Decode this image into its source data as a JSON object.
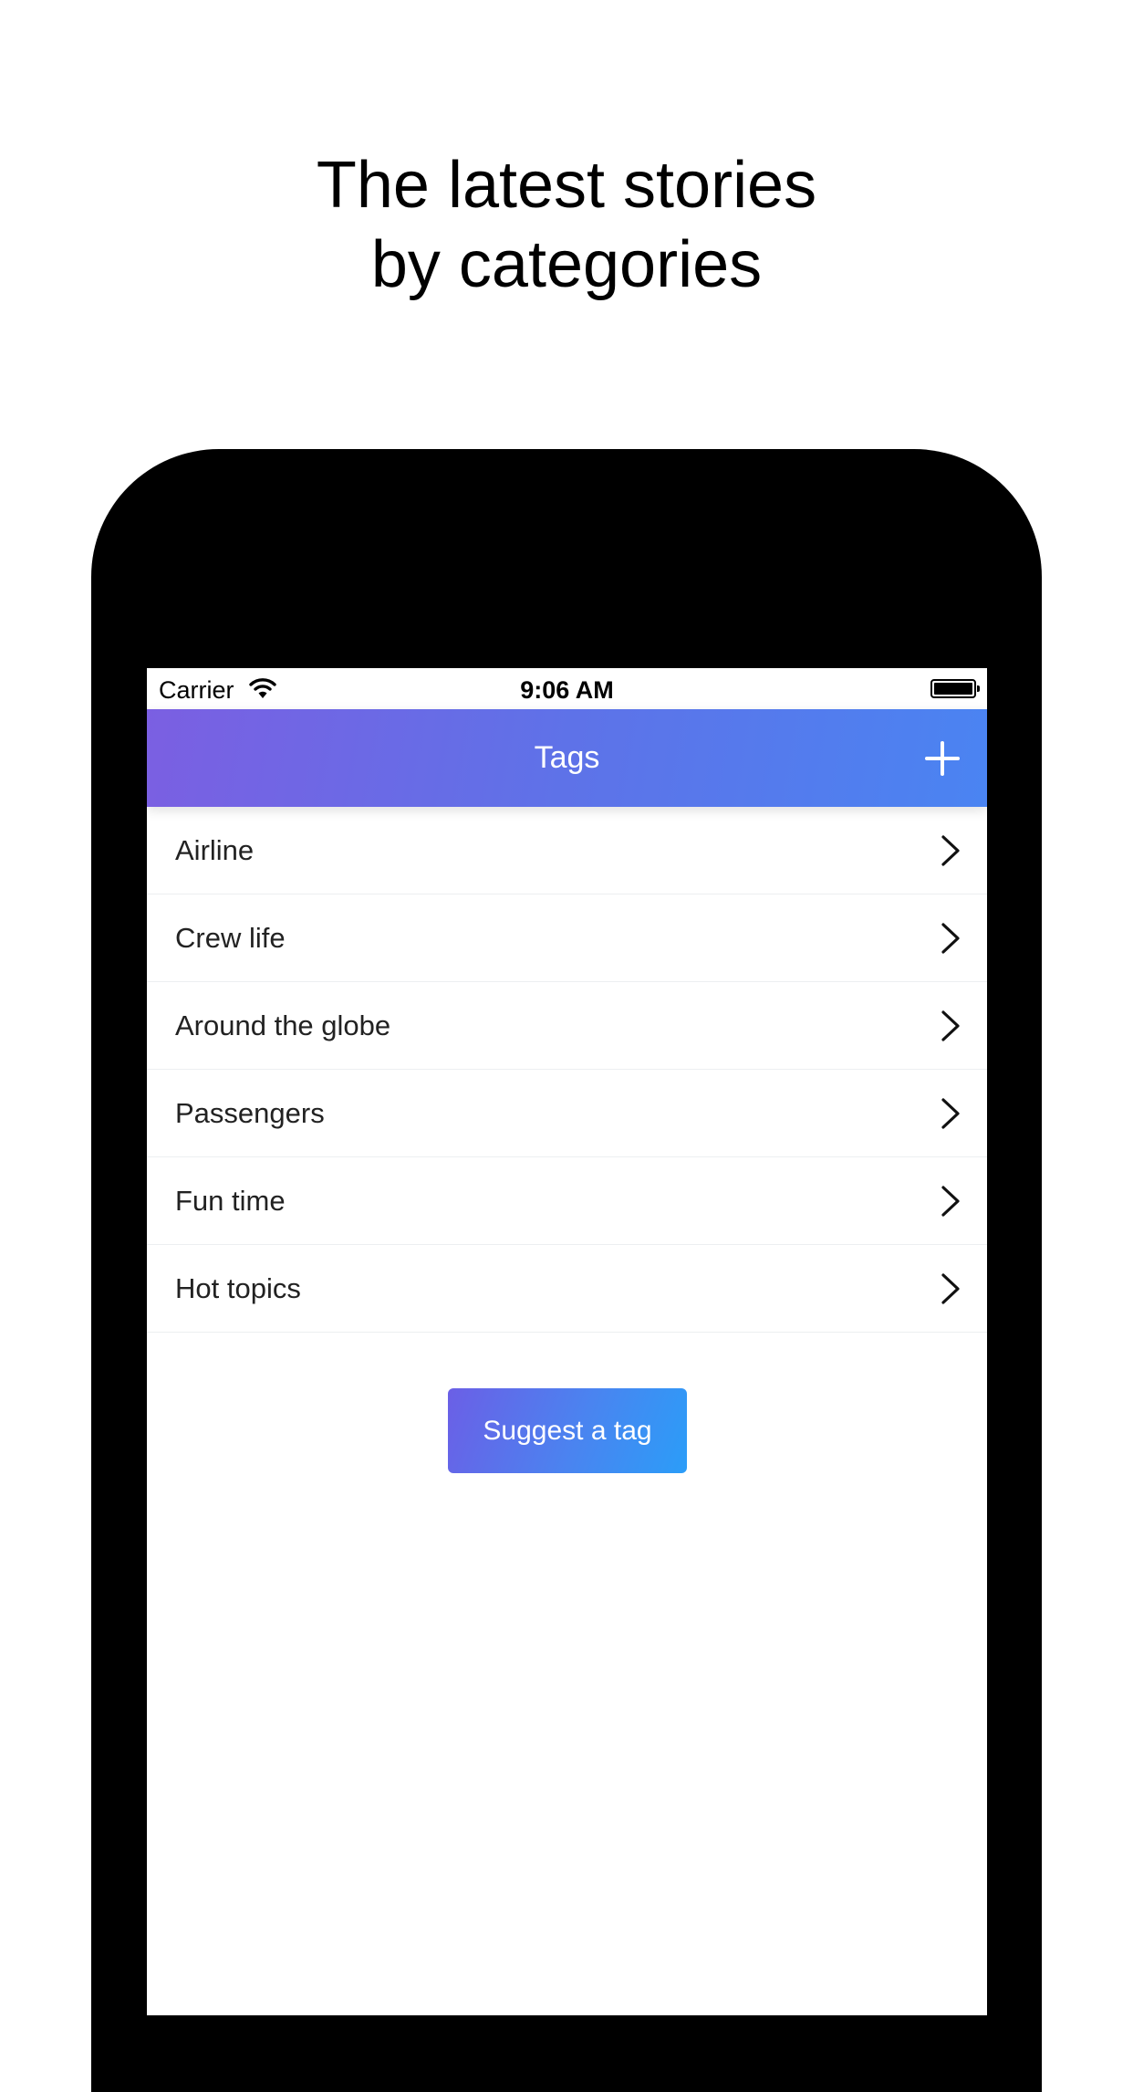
{
  "headline": {
    "line1": "The latest stories",
    "line2": "by categories"
  },
  "status_bar": {
    "carrier": "Carrier",
    "time": "9:06 AM",
    "battery_level": 1.0
  },
  "nav": {
    "title": "Tags",
    "add_icon": "plus-icon"
  },
  "tags": [
    {
      "label": "Airline"
    },
    {
      "label": "Crew life"
    },
    {
      "label": "Around the globe"
    },
    {
      "label": "Passengers"
    },
    {
      "label": "Fun time"
    },
    {
      "label": "Hot topics"
    }
  ],
  "suggest_button": {
    "label": "Suggest a tag"
  },
  "colors": {
    "nav_gradient_start": "#7b5fe2",
    "nav_gradient_end": "#4a84f2",
    "button_gradient_start": "#6b5fe6",
    "button_gradient_end": "#2b9df8",
    "device_frame": "#000000"
  }
}
